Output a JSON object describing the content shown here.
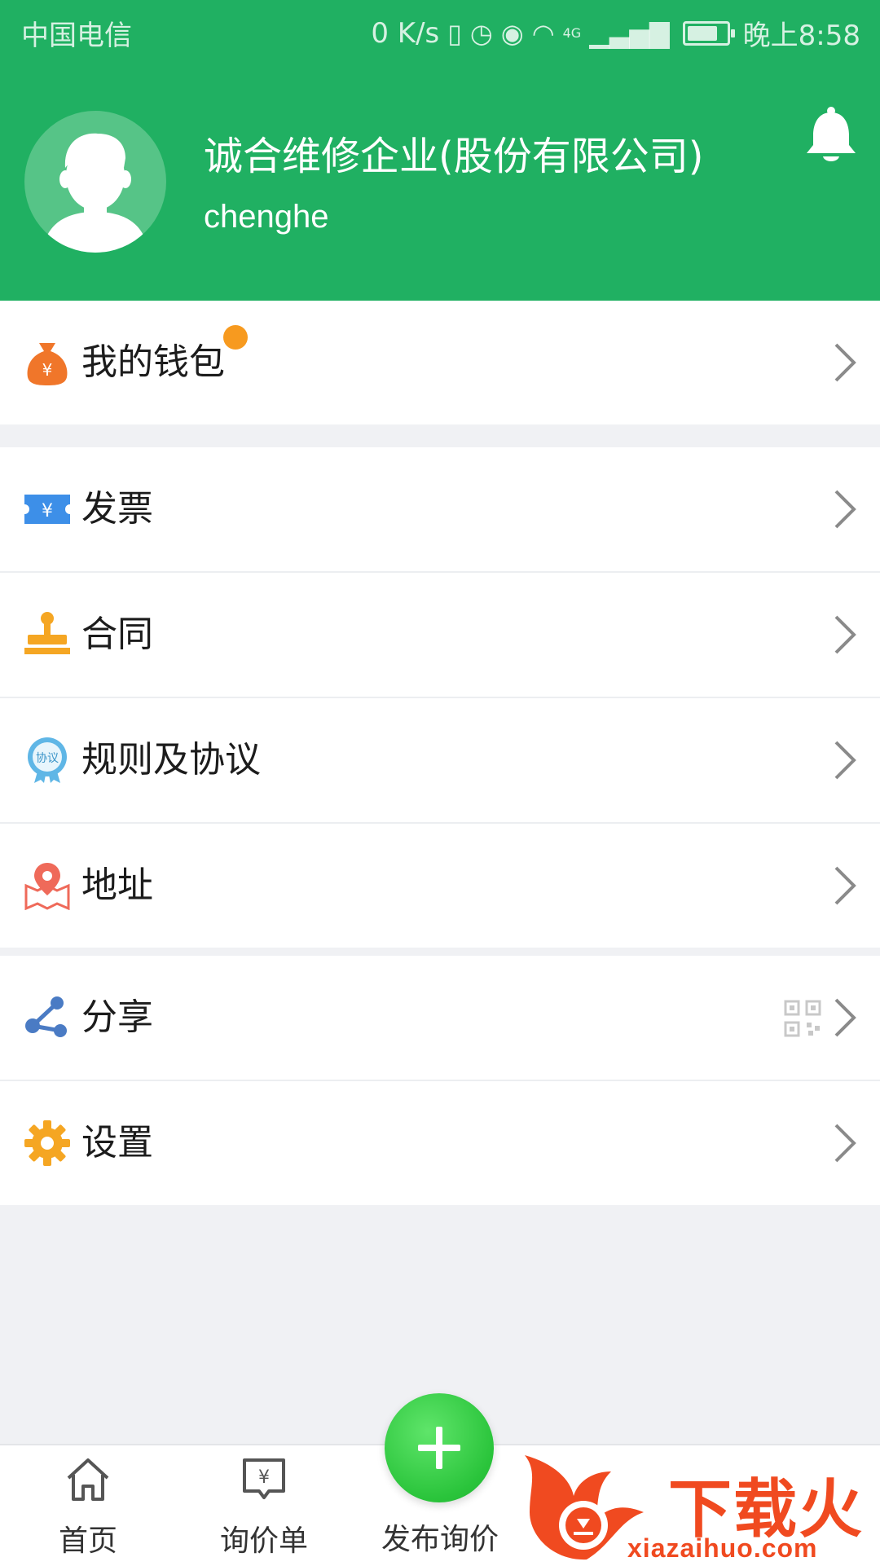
{
  "status_bar": {
    "carrier": "中国电信",
    "speed": "0 K/s",
    "network": "4G",
    "time": "晚上8:58"
  },
  "profile": {
    "company_name": "诚合维修企业(股份有限公司)",
    "username": "chenghe"
  },
  "menu_groups": [
    [
      {
        "label": "我的钱包",
        "icon": "money-bag-icon",
        "badge": true
      }
    ],
    [
      {
        "label": "发票",
        "icon": "ticket-icon"
      },
      {
        "label": "合同",
        "icon": "stamp-icon"
      },
      {
        "label": "规则及协议",
        "icon": "agreement-badge-icon",
        "icon_text": "协议"
      },
      {
        "label": "地址",
        "icon": "map-pin-icon"
      }
    ],
    [
      {
        "label": "分享",
        "icon": "share-icon",
        "qr": true
      },
      {
        "label": "设置",
        "icon": "gear-icon"
      }
    ]
  ],
  "tabbar": {
    "home": "首页",
    "inquiry_list": "询价单",
    "publish": "发布询价"
  },
  "watermark": {
    "brand": "下载火",
    "url": "xiazaihuo.com"
  },
  "colors": {
    "brand_green": "#20b062",
    "badge_orange": "#f79a1f",
    "fab_green": "#2ac43b"
  }
}
